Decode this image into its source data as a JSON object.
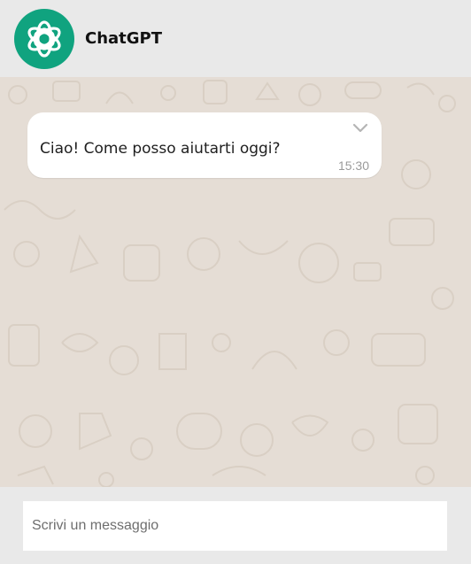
{
  "header": {
    "title": "ChatGPT",
    "avatar_icon": "openai-logo-icon",
    "avatar_color": "#10a37f"
  },
  "chat": {
    "background_color": "#e5ddd5",
    "messages": [
      {
        "text": "Ciao! Come posso aiutarti oggi?",
        "time": "15:30",
        "menu_icon": "chevron-down-icon"
      }
    ]
  },
  "composer": {
    "placeholder": "Scrivi un messaggio",
    "value": ""
  }
}
